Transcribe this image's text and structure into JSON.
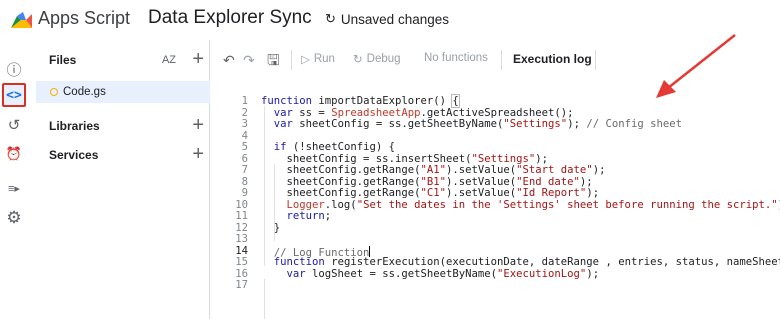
{
  "header": {
    "app_name": "Apps Script",
    "project_name": "Data Explorer Sync",
    "status": "Unsaved changes"
  },
  "rail": {
    "items": [
      {
        "icon": "info-icon",
        "glyph": "ⓘ"
      },
      {
        "icon": "code-editor-icon",
        "glyph": "<>",
        "active": true
      },
      {
        "icon": "history-icon",
        "glyph": "↺"
      },
      {
        "icon": "triggers-alarm-icon",
        "glyph": "⏰"
      },
      {
        "icon": "executions-icon",
        "glyph": "≡▸"
      },
      {
        "icon": "settings-gear-icon",
        "glyph": "⚙"
      }
    ]
  },
  "files_panel": {
    "files_label": "Files",
    "sort_label": "AZ",
    "file_name": "Code.gs",
    "libraries_label": "Libraries",
    "services_label": "Services"
  },
  "toolbar": {
    "undo": "↶",
    "redo": "↷",
    "save": "🖫",
    "run": "Run",
    "debug": "Debug",
    "functions": "No functions",
    "execution_log": "Execution log"
  },
  "editor": {
    "line_numbers": [
      "1",
      "2",
      "3",
      "4",
      "5",
      "6",
      "7",
      "8",
      "9",
      "10",
      "11",
      "12",
      "13",
      "14",
      "15",
      "16",
      "17"
    ],
    "lines": [
      "function importDataExplorer() {",
      "  var ss = SpreadsheetApp.getActiveSpreadsheet();",
      "  var sheetConfig = ss.getSheetByName(\"Settings\"); // Config sheet",
      "",
      "  if (!sheetConfig) {",
      "    sheetConfig = ss.insertSheet(\"Settings\");",
      "    sheetConfig.getRange(\"A1\").setValue(\"Start date\");",
      "    sheetConfig.getRange(\"B1\").setValue(\"End date\");",
      "    sheetConfig.getRange(\"C1\").setValue(\"Id Report\");",
      "    Logger.log(\"Set the dates in the 'Settings' sheet before running the script.\");",
      "    return;",
      "  }",
      "",
      "  // Log Function",
      "  function registerExecution(executionDate, dateRange , entries, status, nameSheet) {",
      "    var logSheet = ss.getSheetByName(\"ExecutionLog\");",
      ""
    ]
  },
  "colors": {
    "accent": "#1a73e8",
    "annotation_red": "#e53935",
    "active_rail_border": "#d93025"
  }
}
